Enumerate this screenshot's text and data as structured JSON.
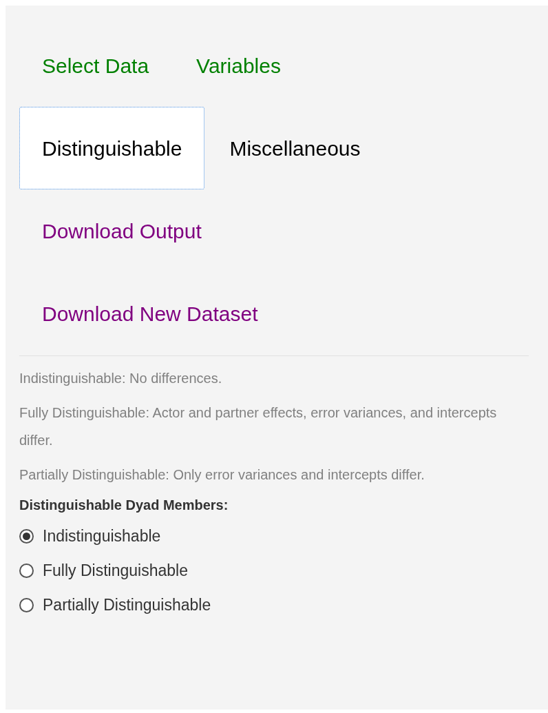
{
  "tabs": [
    {
      "label": "Select Data",
      "selected": false,
      "color": "#008000"
    },
    {
      "label": "Variables",
      "selected": false,
      "color": "#008000"
    },
    {
      "label": "Distinguishable",
      "selected": true,
      "color": "#000000"
    },
    {
      "label": "Miscellaneous",
      "selected": false,
      "color": "#000000"
    },
    {
      "label": "Download Output",
      "selected": false,
      "color": "#800080"
    },
    {
      "label": "Download New Dataset",
      "selected": false,
      "color": "#800080"
    }
  ],
  "help_texts": [
    "Indistinguishable: No differences.",
    "Fully Distinguishable: Actor and partner effects, error variances, and intercepts differ.",
    "Partially Distinguishable: Only error variances and intercepts differ."
  ],
  "radio_group": {
    "label": "Distinguishable Dyad Members:",
    "options": [
      {
        "label": "Indistinguishable",
        "selected": true
      },
      {
        "label": "Fully Distinguishable",
        "selected": false
      },
      {
        "label": "Partially Distinguishable",
        "selected": false
      }
    ]
  }
}
